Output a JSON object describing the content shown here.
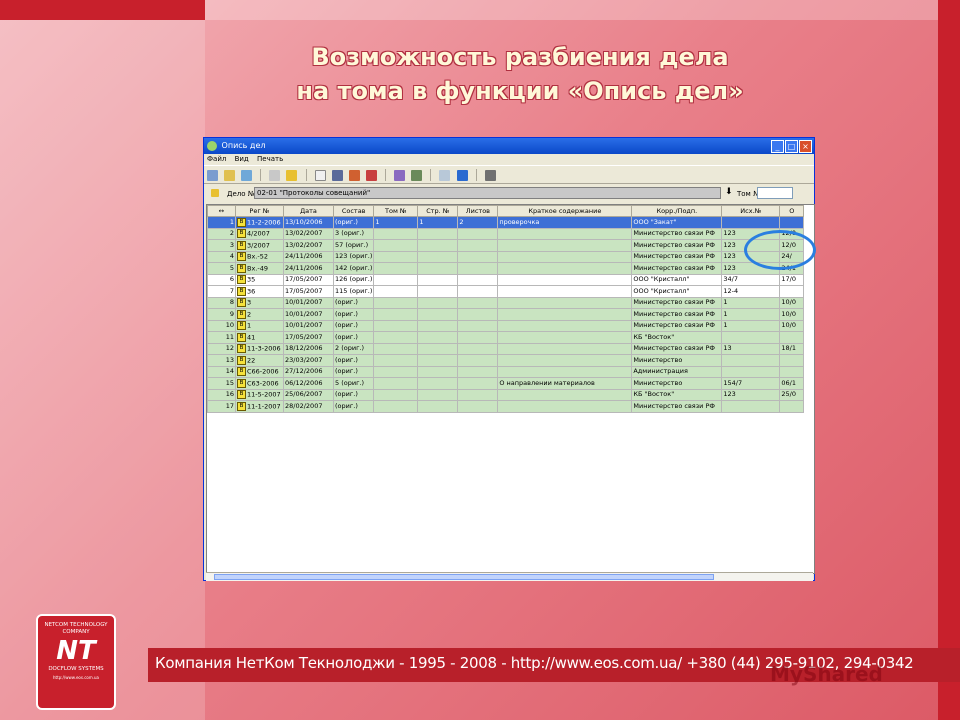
{
  "slide": {
    "title_line1": "Возможность разбиения дела",
    "title_line2": "на тома в функции «Опись дел»",
    "footer": "Компания НетКом Текнолоджи - 1995 - 2008 - http://www.eos.com.ua/ +380 (44) 295-9102, 294-0342",
    "logo_top": "NETCOM TECHNOLOGY COMPANY",
    "logo_mark": "NT",
    "logo_bottom": "DOCFLOW SYSTEMS",
    "logo_url": "http://www.eos.com.ua",
    "watermark": "MyShared"
  },
  "window": {
    "title": "Опись дел",
    "menu": [
      "Файл",
      "Вид",
      "Печать"
    ],
    "delo_label": "Дело №:",
    "delo_value": "02-01 \"Протоколы совещаний\"",
    "tom_label": "Том №:",
    "columns": [
      "Рег №",
      "Дата",
      "Состав",
      "Том №",
      "Стр. №",
      "Листов",
      "Краткое содержание",
      "Корр./Подп.",
      "Исх.№",
      "О"
    ],
    "rows": [
      {
        "n": "1",
        "reg": "11-2-2006",
        "date": "13/10/2006",
        "sostav": "(ориг.)",
        "tom": "1",
        "str": "1",
        "list": "2",
        "kratk": "проверочка",
        "korr": "ООО \"Закат\"",
        "ish": "",
        "o": ""
      },
      {
        "n": "2",
        "reg": "4/2007",
        "date": "13/02/2007",
        "sostav": "3 (ориг.)",
        "tom": "",
        "str": "",
        "list": "",
        "kratk": "",
        "korr": "Министерство связи РФ",
        "ish": "123",
        "o": "12/0"
      },
      {
        "n": "3",
        "reg": "3/2007",
        "date": "13/02/2007",
        "sostav": "57 (ориг.)",
        "tom": "",
        "str": "",
        "list": "",
        "kratk": "",
        "korr": "Министерство связи РФ",
        "ish": "123",
        "o": "12/0"
      },
      {
        "n": "4",
        "reg": "Вх.-52",
        "date": "24/11/2006",
        "sostav": "123 (ориг.)",
        "tom": "",
        "str": "",
        "list": "",
        "kratk": "",
        "korr": "Министерство связи РФ",
        "ish": "123",
        "o": "24/"
      },
      {
        "n": "5",
        "reg": "Вх.-49",
        "date": "24/11/2006",
        "sostav": "142 (ориг.)",
        "tom": "",
        "str": "",
        "list": "",
        "kratk": "",
        "korr": "Министерство связи РФ",
        "ish": "123",
        "o": "24/1"
      },
      {
        "n": "6",
        "reg": "35",
        "date": "17/05/2007",
        "sostav": "126 (ориг.)",
        "tom": "",
        "str": "",
        "list": "",
        "kratk": "",
        "korr": "ООО \"Кристалл\"",
        "ish": "34/7",
        "o": "17/0"
      },
      {
        "n": "7",
        "reg": "36",
        "date": "17/05/2007",
        "sostav": "115 (ориг.)",
        "tom": "",
        "str": "",
        "list": "",
        "kratk": "",
        "korr": "ООО \"Кристалл\"",
        "ish": "12-4",
        "o": ""
      },
      {
        "n": "8",
        "reg": "3",
        "date": "10/01/2007",
        "sostav": "(ориг.)",
        "tom": "",
        "str": "",
        "list": "",
        "kratk": "",
        "korr": "Министерство связи РФ",
        "ish": "1",
        "o": "10/0"
      },
      {
        "n": "9",
        "reg": "2",
        "date": "10/01/2007",
        "sostav": "(ориг.)",
        "tom": "",
        "str": "",
        "list": "",
        "kratk": "",
        "korr": "Министерство связи РФ",
        "ish": "1",
        "o": "10/0"
      },
      {
        "n": "10",
        "reg": "1",
        "date": "10/01/2007",
        "sostav": "(ориг.)",
        "tom": "",
        "str": "",
        "list": "",
        "kratk": "",
        "korr": "Министерство связи РФ",
        "ish": "1",
        "o": "10/0"
      },
      {
        "n": "11",
        "reg": "41",
        "date": "17/05/2007",
        "sostav": "(ориг.)",
        "tom": "",
        "str": "",
        "list": "",
        "kratk": "",
        "korr": "КБ \"Восток\"",
        "ish": "",
        "o": ""
      },
      {
        "n": "12",
        "reg": "11-3-2006",
        "date": "18/12/2006",
        "sostav": "2 (ориг.)",
        "tom": "",
        "str": "",
        "list": "",
        "kratk": "",
        "korr": "Министерство связи РФ",
        "ish": "13",
        "o": "18/1"
      },
      {
        "n": "13",
        "reg": "22",
        "date": "23/03/2007",
        "sostav": "(ориг.)",
        "tom": "",
        "str": "",
        "list": "",
        "kratk": "",
        "korr": "Министерство",
        "ish": "",
        "o": ""
      },
      {
        "n": "14",
        "reg": "С66-2006",
        "date": "27/12/2006",
        "sostav": "(ориг.)",
        "tom": "",
        "str": "",
        "list": "",
        "kratk": "",
        "korr": "Администрация",
        "ish": "",
        "o": ""
      },
      {
        "n": "15",
        "reg": "С63-2006",
        "date": "06/12/2006",
        "sostav": "5 (ориг.)",
        "tom": "",
        "str": "",
        "list": "",
        "kratk": "О направлении материалов",
        "korr": "Министерство",
        "ish": "154/7",
        "o": "06/1"
      },
      {
        "n": "16",
        "reg": "11-5-2007",
        "date": "25/06/2007",
        "sostav": "(ориг.)",
        "tom": "",
        "str": "",
        "list": "",
        "kratk": "",
        "korr": "КБ \"Восток\"",
        "ish": "123",
        "o": "25/0"
      },
      {
        "n": "17",
        "reg": "11-1-2007",
        "date": "28/02/2007",
        "sostav": "(ориг.)",
        "tom": "",
        "str": "",
        "list": "",
        "kratk": "",
        "korr": "Министерство связи РФ",
        "ish": "",
        "o": ""
      }
    ]
  }
}
